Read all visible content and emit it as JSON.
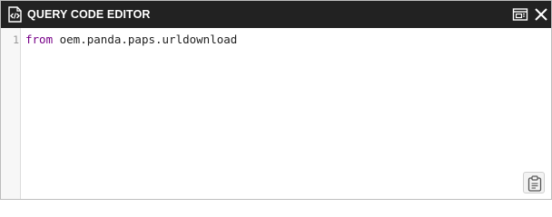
{
  "header": {
    "title": "QUERY CODE EDITOR",
    "title_icon": "code-file-icon",
    "actions": [
      {
        "name": "expand",
        "icon": "expand-window-icon"
      },
      {
        "name": "close",
        "icon": "close-icon"
      }
    ]
  },
  "editor": {
    "lines": [
      {
        "number": "1",
        "keyword": "from",
        "rest": " oem.panda.paps.urldownload"
      }
    ],
    "copy_icon": "clipboard-icon"
  },
  "colors": {
    "header_bg": "#222222",
    "keyword": "#770088",
    "gutter_bg": "#f7f7f7"
  }
}
